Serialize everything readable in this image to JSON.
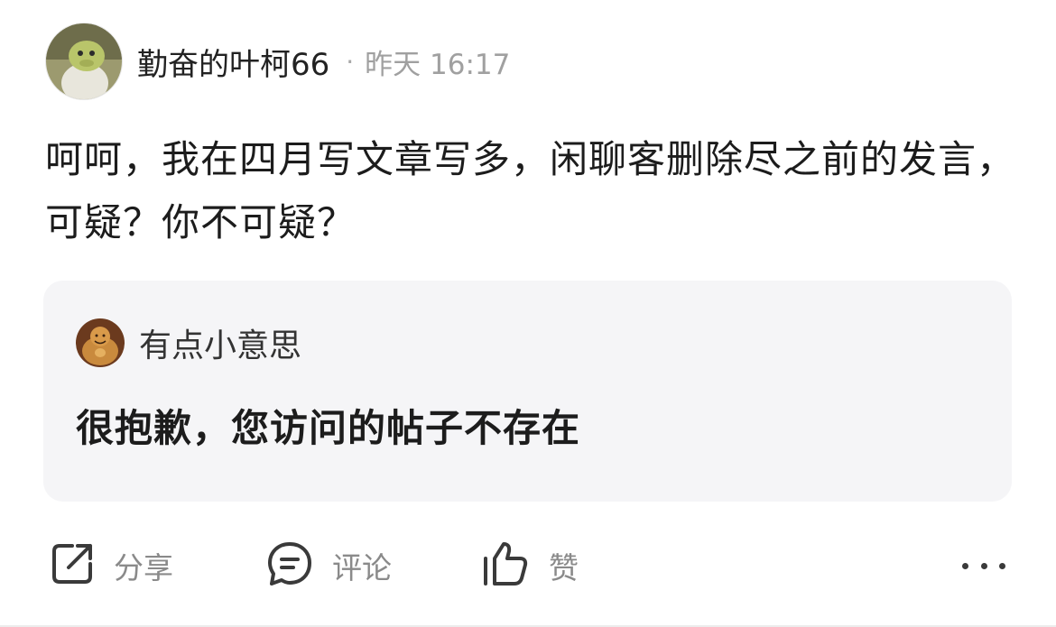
{
  "post": {
    "author": "勤奋的叶柯66",
    "separator": "·",
    "time": "昨天 16:17",
    "content": "呵呵，我在四月写文章写多，闲聊客删除尽之前的发言，可疑？你不可疑？"
  },
  "quote": {
    "user": "有点小意思",
    "text": "很抱歉，您访问的帖子不存在"
  },
  "actions": {
    "share_label": "分享",
    "comment_label": "评论",
    "like_label": "赞"
  },
  "icons": {
    "share": "share-icon",
    "comment": "comment-icon",
    "like": "thumbs-up-icon",
    "more": "more-icon"
  },
  "colors": {
    "card_background": "#f5f5f7",
    "meta_text": "#a0a0a0",
    "action_text": "#8a8a8a"
  }
}
